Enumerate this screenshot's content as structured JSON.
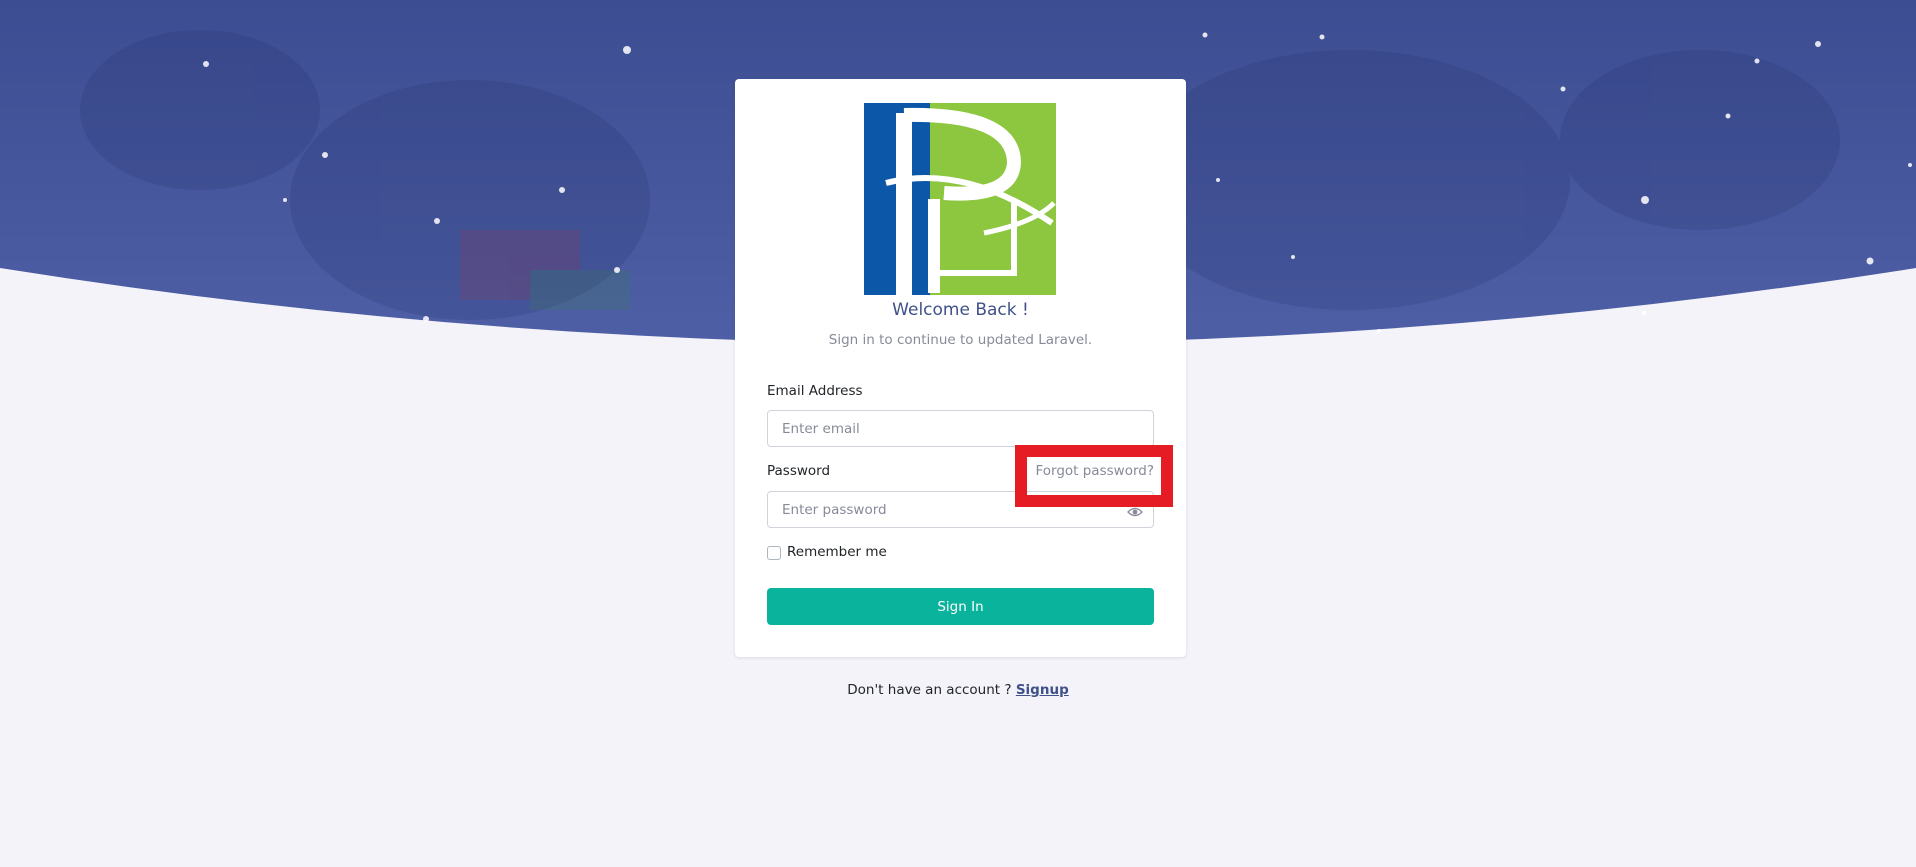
{
  "auth": {
    "welcome_title": "Welcome Back !",
    "subtitle": "Sign in to continue to updated Laravel.",
    "email_label": "Email Address",
    "email_placeholder": "Enter email",
    "password_label": "Password",
    "forgot_password": "Forgot password?",
    "password_placeholder": "Enter password",
    "remember_label": "Remember me",
    "signin_button": "Sign In"
  },
  "footer": {
    "text": "Don't have an account ?",
    "signup_link": "Signup"
  },
  "icons": {
    "password_toggle": "eye-icon"
  },
  "colors": {
    "hero": "#4a5aa0",
    "primary": "#405189",
    "success": "#0ab39c",
    "highlight": "#e51c23"
  }
}
